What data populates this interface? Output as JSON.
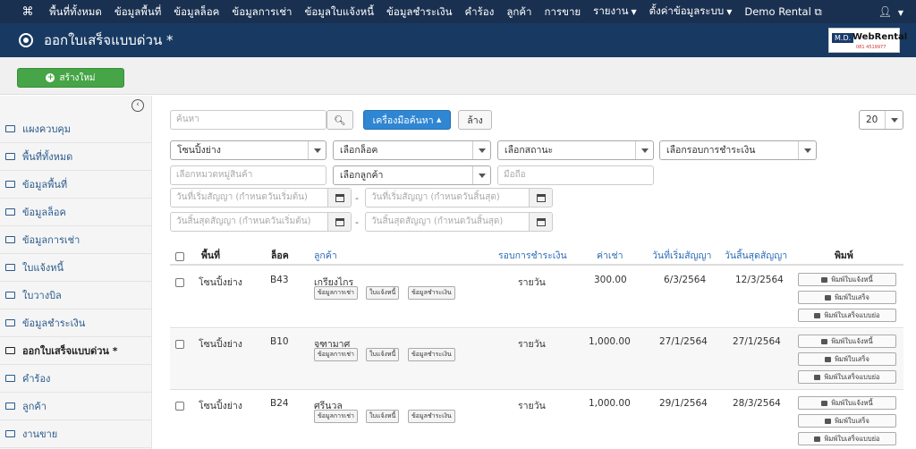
{
  "topnav": {
    "logo": "⌘",
    "items": [
      "พื้นที่ทั้งหมด",
      "ข้อมูลพื้นที่",
      "ข้อมูลล็อค",
      "ข้อมูลการเช่า",
      "ข้อมูลใบแจ้งหนี้",
      "ข้อมูลชำระเงิน",
      "คำร้อง",
      "ลูกค้า",
      "การขาย"
    ],
    "report": "รายงาน",
    "settings": "ตั้งค่าข้อมูลระบบ",
    "demo": "Demo Rental",
    "user_icon": "user-icon"
  },
  "header": {
    "title": "ออกใบเสร็จแบบด่วน *",
    "brand_md": "M.D.",
    "brand_name": "WebRental",
    "brand_phone": "081 4519977"
  },
  "toolbar": {
    "new_label": "สร้างใหม่"
  },
  "sidebar": {
    "items": [
      {
        "label": "แผงควบคุม"
      },
      {
        "label": "พื้นที่ทั้งหมด"
      },
      {
        "label": "ข้อมูลพื้นที่"
      },
      {
        "label": "ข้อมูลล็อค"
      },
      {
        "label": "ข้อมูลการเช่า"
      },
      {
        "label": "ใบแจ้งหนี้"
      },
      {
        "label": "ใบวางบิล"
      },
      {
        "label": "ข้อมูลชำระเงิน"
      },
      {
        "label": "ออกใบเสร็จแบบด่วน *"
      },
      {
        "label": "คำร้อง"
      },
      {
        "label": "ลูกค้า"
      },
      {
        "label": "งานขาย"
      }
    ]
  },
  "search": {
    "placeholder": "ค้นหา",
    "tools_label": "เครื่องมือค้นหา",
    "clear_label": "ล้าง",
    "page_size": "20"
  },
  "filters": {
    "zone": "โซนปิ้งย่าง",
    "lock": "เลือกล็อค",
    "status": "เลือกสถานะ",
    "cycle": "เลือกรอบการชำระเงิน",
    "category_placeholder": "เลือกหมวดหมู่สินค้า",
    "customer": "เลือกลูกค้า",
    "mobile_placeholder": "มือถือ",
    "start_from": "วันที่เริ่มสัญญา (กำหนดวันเริ่มต้น)",
    "start_to": "วันที่เริ่มสัญญา (กำหนดวันสิ้นสุด)",
    "end_from": "วันสิ้นสุดสัญญา (กำหนดวันเริ่มต้น)",
    "end_to": "วันสิ้นสุดสัญญา (กำหนดวันสิ้นสุด)"
  },
  "table": {
    "headers": {
      "area": "พื้นที่",
      "lock": "ล็อค",
      "customer": "ลูกค้า",
      "cycle": "รอบการชำระเงิน",
      "rent": "ค่าเช่า",
      "start": "วันที่เริ่มสัญญา",
      "end": "วันสิ้นสุดสัญญา",
      "print": "พิมพ์"
    },
    "sub_buttons": [
      "ข้อมูลการเช่า",
      "ใบแจ้งหนี้",
      "ข้อมูลชำระเงิน"
    ],
    "print_buttons": [
      "พิมพ์ใบแจ้งหนี้",
      "พิมพ์ใบเสร็จ",
      "พิมพ์ใบเสร็จแบบย่อ"
    ],
    "rows": [
      {
        "area": "โซนปิ้งย่าง",
        "lock": "B43",
        "customer": "เกรียงไกร",
        "cycle": "รายวัน",
        "rent": "300.00",
        "start": "6/3/2564",
        "end": "12/3/2564"
      },
      {
        "area": "โซนปิ้งย่าง",
        "lock": "B10",
        "customer": "จุฑามาศ",
        "cycle": "รายวัน",
        "rent": "1,000.00",
        "start": "27/1/2564",
        "end": "27/1/2564"
      },
      {
        "area": "โซนปิ้งย่าง",
        "lock": "B24",
        "customer": "ศรีนวล",
        "cycle": "รายวัน",
        "rent": "1,000.00",
        "start": "29/1/2564",
        "end": "28/3/2564"
      }
    ]
  }
}
